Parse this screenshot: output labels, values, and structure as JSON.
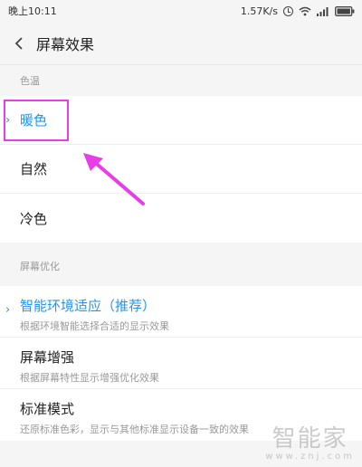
{
  "status_bar": {
    "time": "晚上10:11",
    "speed": "1.57K/s",
    "icons": [
      "alarm-icon",
      "wifi-icon",
      "signal-icon",
      "battery-icon"
    ]
  },
  "header": {
    "title": "屏幕效果",
    "back_icon": "chevron-left-icon"
  },
  "color_temp": {
    "section_title": "色温",
    "options": [
      {
        "label": "暖色",
        "selected": true
      },
      {
        "label": "自然",
        "selected": false
      },
      {
        "label": "冷色",
        "selected": false
      }
    ]
  },
  "optimize": {
    "section_title": "屏幕优化",
    "options": [
      {
        "label": "智能环境适应（推荐）",
        "desc": "根据环境智能选择合适的显示效果",
        "selected": true
      },
      {
        "label": "屏幕增强",
        "desc": "根据屏幕特性显示增强优化效果",
        "selected": false
      },
      {
        "label": "标准模式",
        "desc": "还原标准色彩，显示与其他标准显示设备一致的效果",
        "selected": false
      }
    ]
  },
  "annotation": {
    "color": "#e83ee8"
  },
  "accent_color": "#2196f3",
  "watermark": {
    "text": "智能家",
    "url": "www.znj.com"
  }
}
